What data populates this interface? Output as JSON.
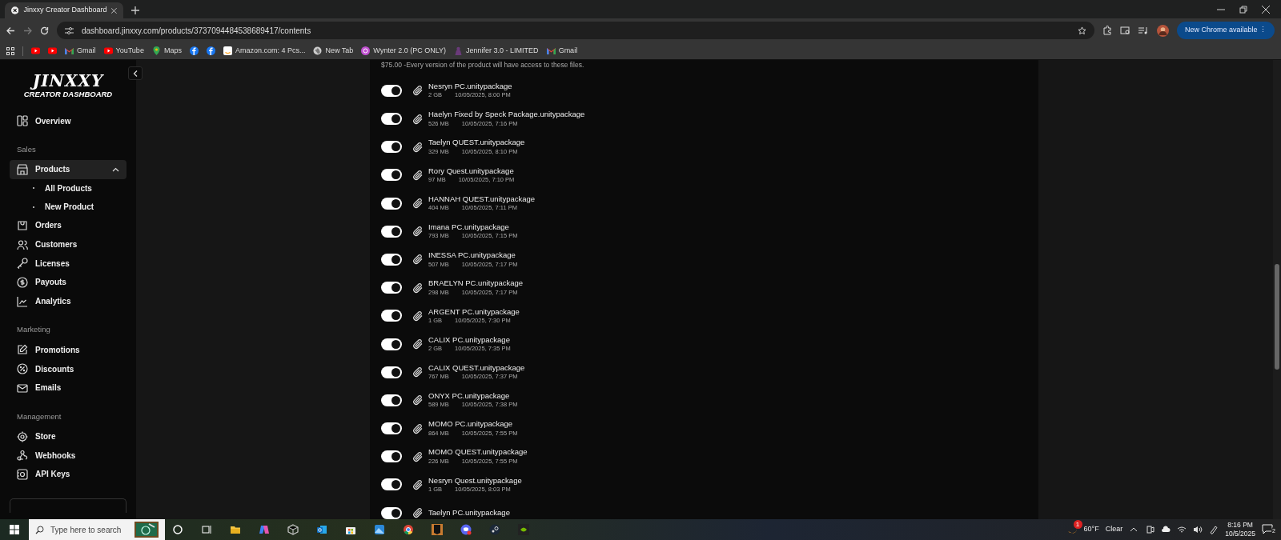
{
  "browser": {
    "tab_title": "Jinxxy Creator Dashboard",
    "url": "dashboard.jinxxy.com/products/3737094484538689417/contents",
    "update_button": "New Chrome available",
    "update_menu": "⋮",
    "bookmarks": [
      {
        "kind": "youtube"
      },
      {
        "kind": "youtube"
      },
      {
        "kind": "gmail",
        "label": "Gmail"
      },
      {
        "kind": "youtube",
        "label": "YouTube"
      },
      {
        "kind": "maps",
        "label": "Maps"
      },
      {
        "kind": "facebook"
      },
      {
        "kind": "facebook"
      },
      {
        "kind": "amazon",
        "label": "Amazon.com: 4 Pcs..."
      },
      {
        "kind": "globe",
        "label": "New Tab"
      },
      {
        "kind": "circle",
        "label": "Wynter 2.0 (PC ONLY)"
      },
      {
        "kind": "figure",
        "label": "Jennifer 3.0 - LIMITED"
      },
      {
        "kind": "gmail",
        "label": "Gmail"
      }
    ]
  },
  "sidebar": {
    "logo_title": "JINXXY",
    "logo_subtitle": "CREATOR DASHBOARD",
    "groups": [
      {
        "items": [
          {
            "label": "Overview",
            "selected": false
          }
        ]
      },
      {
        "heading": "Sales",
        "items": [
          {
            "label": "Products",
            "selected": true,
            "expanded": true,
            "children": [
              {
                "label": "All Products"
              },
              {
                "label": "New Product"
              }
            ]
          },
          {
            "label": "Orders",
            "selected": false
          },
          {
            "label": "Customers",
            "selected": false
          },
          {
            "label": "Licenses",
            "selected": false
          },
          {
            "label": "Payouts",
            "selected": false
          },
          {
            "label": "Analytics",
            "selected": false
          }
        ]
      },
      {
        "heading": "Marketing",
        "items": [
          {
            "label": "Promotions",
            "selected": false
          },
          {
            "label": "Discounts",
            "selected": false
          },
          {
            "label": "Emails",
            "selected": false
          }
        ]
      },
      {
        "heading": "Management",
        "items": [
          {
            "label": "Store",
            "selected": false
          },
          {
            "label": "Webhooks",
            "selected": false
          },
          {
            "label": "API Keys",
            "selected": false
          }
        ]
      }
    ]
  },
  "content": {
    "description": "$75.00 -Every version of the product will have access to these files.",
    "files": [
      {
        "name": "Nesryn PC.unitypackage",
        "size": "2 GB",
        "date": "10/05/2025, 8:00 PM",
        "on": true
      },
      {
        "name": "Haelyn Fixed by Speck Package.unitypackage",
        "size": "526 MB",
        "date": "10/05/2025, 7:16 PM",
        "on": true
      },
      {
        "name": "Taelyn QUEST.unitypackage",
        "size": "329 MB",
        "date": "10/05/2025, 8:10 PM",
        "on": true
      },
      {
        "name": "Rory Quest.unitypackage",
        "size": "97 MB",
        "date": "10/05/2025, 7:10 PM",
        "on": true
      },
      {
        "name": "HANNAH QUEST.unitypackage",
        "size": "404 MB",
        "date": "10/05/2025, 7:11 PM",
        "on": true
      },
      {
        "name": "Imana PC.unitypackage",
        "size": "793 MB",
        "date": "10/05/2025, 7:15 PM",
        "on": true
      },
      {
        "name": "INESSA PC.unitypackage",
        "size": "507 MB",
        "date": "10/05/2025, 7:17 PM",
        "on": true
      },
      {
        "name": "BRAELYN PC.unitypackage",
        "size": "298 MB",
        "date": "10/05/2025, 7:17 PM",
        "on": true
      },
      {
        "name": "ARGENT PC.unitypackage",
        "size": "1 GB",
        "date": "10/05/2025, 7:30 PM",
        "on": true
      },
      {
        "name": "CALIX PC.unitypackage",
        "size": "2 GB",
        "date": "10/05/2025, 7:35 PM",
        "on": true
      },
      {
        "name": "CALIX QUEST.unitypackage",
        "size": "767 MB",
        "date": "10/05/2025, 7:37 PM",
        "on": true
      },
      {
        "name": "ONYX PC.unitypackage",
        "size": "589 MB",
        "date": "10/05/2025, 7:38 PM",
        "on": true
      },
      {
        "name": "MOMO PC.unitypackage",
        "size": "864 MB",
        "date": "10/05/2025, 7:55 PM",
        "on": true
      },
      {
        "name": "MOMO QUEST.unitypackage",
        "size": "226 MB",
        "date": "10/05/2025, 7:55 PM",
        "on": true
      },
      {
        "name": "Nesryn Quest.unitypackage",
        "size": "1 GB",
        "date": "10/05/2025, 8:03 PM",
        "on": true
      },
      {
        "name": "Taelyn PC.unitypackage",
        "on": true
      }
    ]
  },
  "taskbar": {
    "search_placeholder": "Type here to search",
    "weather_temp": "60°F",
    "weather_text": "Clear",
    "weather_badge": "1",
    "time": "8:16 PM",
    "date": "10/5/2025",
    "notifications": "2"
  }
}
